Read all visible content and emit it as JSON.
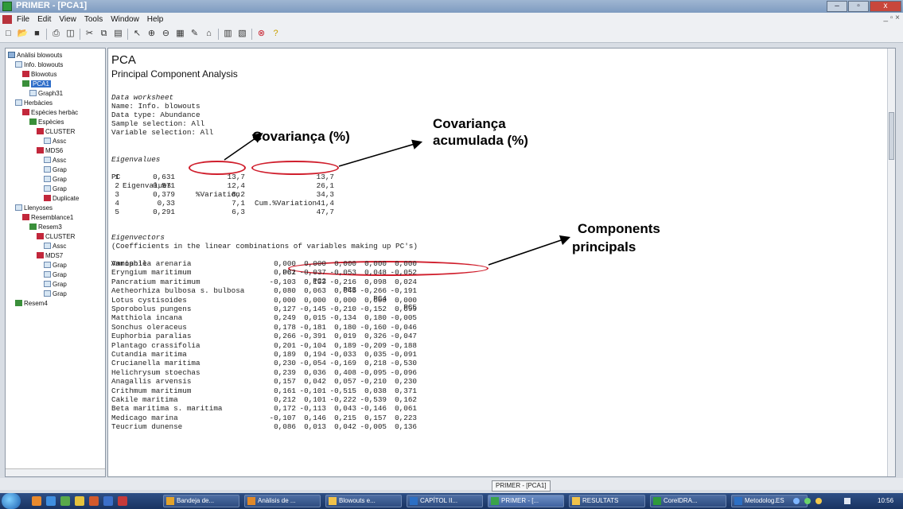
{
  "window": {
    "title": "PRIMER - [PCA1]",
    "controls": {
      "minimize": "–",
      "maximize": "▫",
      "close": "x"
    }
  },
  "menu": {
    "items": [
      "File",
      "Edit",
      "View",
      "Tools",
      "Window",
      "Help"
    ],
    "mdi_controls": "_ ▫ ×"
  },
  "toolbar": {
    "icons": [
      "new-file-icon",
      "open-folder-icon",
      "save-icon",
      "print-icon",
      "print-preview-icon",
      "cut-icon",
      "copy-icon",
      "paste-icon",
      "pointer-icon",
      "zoom-in-icon",
      "zoom-out-icon",
      "table-icon",
      "edit-icon",
      "clipboard-icon",
      "chart-icon",
      "graph-icon",
      "stop-icon",
      "help-icon"
    ]
  },
  "tree": [
    {
      "label": "Anàlisi blowouts",
      "icon": "book",
      "indent": 0
    },
    {
      "label": "Info. blowouts",
      "icon": "doc",
      "indent": 1
    },
    {
      "label": "Blowotus",
      "icon": "ws",
      "indent": 2
    },
    {
      "label": "PCA1",
      "icon": "res",
      "indent": 2,
      "selected": true
    },
    {
      "label": "Graph31",
      "icon": "doc",
      "indent": 3
    },
    {
      "label": "Herbàcies",
      "icon": "doc",
      "indent": 1
    },
    {
      "label": "Espècies herbàc",
      "icon": "ws",
      "indent": 2
    },
    {
      "label": "Espècies",
      "icon": "res",
      "indent": 3
    },
    {
      "label": "CLUSTER",
      "icon": "ws",
      "indent": 4
    },
    {
      "label": "Assc",
      "icon": "doc",
      "indent": 5
    },
    {
      "label": "MDS6",
      "icon": "ws",
      "indent": 4
    },
    {
      "label": "Assc",
      "icon": "doc",
      "indent": 5
    },
    {
      "label": "Grap",
      "icon": "doc",
      "indent": 5
    },
    {
      "label": "Grap",
      "icon": "doc",
      "indent": 5
    },
    {
      "label": "Grap",
      "icon": "doc",
      "indent": 5
    },
    {
      "label": "Duplicate",
      "icon": "ws",
      "indent": 5
    },
    {
      "label": "Llenyoses",
      "icon": "doc",
      "indent": 1
    },
    {
      "label": "Resemblance1",
      "icon": "ws",
      "indent": 2
    },
    {
      "label": "Resem3",
      "icon": "res",
      "indent": 3
    },
    {
      "label": "CLUSTER",
      "icon": "ws",
      "indent": 4
    },
    {
      "label": "Assc",
      "icon": "doc",
      "indent": 5
    },
    {
      "label": "MDS7",
      "icon": "ws",
      "indent": 4
    },
    {
      "label": "Grap",
      "icon": "doc",
      "indent": 5
    },
    {
      "label": "Grap",
      "icon": "doc",
      "indent": 5
    },
    {
      "label": "Grap",
      "icon": "doc",
      "indent": 5
    },
    {
      "label": "Grap",
      "icon": "doc",
      "indent": 5
    },
    {
      "label": "Resem4",
      "icon": "res",
      "indent": 1
    }
  ],
  "doc": {
    "title": "PCA",
    "subtitle": "Principal Component Analysis",
    "header_lines": [
      "Data worksheet",
      "Name: Info. blowouts",
      "Data type: Abundance",
      "Sample selection: All",
      "Variable selection: All"
    ],
    "eigen_title": "Eigenvalues",
    "eigen_headers": [
      "PC",
      "Eigenvalues",
      "%Variation",
      "Cum.%Variation"
    ],
    "eigenvalues": [
      [
        "1",
        "0,631",
        "13,7",
        "13,7"
      ],
      [
        "2",
        "0,571",
        "12,4",
        "26,1"
      ],
      [
        "3",
        "0,379",
        "8,2",
        "34,3"
      ],
      [
        "4",
        "0,33",
        "7,1",
        "41,4"
      ],
      [
        "5",
        "0,291",
        "6,3",
        "47,7"
      ]
    ],
    "eigvec_title": "Eigenvectors",
    "eigvec_note": "(Coefficients in the linear combinations of variables making up PC's)",
    "eigvec_headers": [
      "Variable",
      "PC1",
      "PC2",
      "PC3",
      "PC4",
      "PC5"
    ],
    "eigenvectors": [
      [
        "Ammophila arenaria",
        "0,000",
        "0,000",
        "0,000",
        "0,000",
        "0,000"
      ],
      [
        "Eryngium maritimum",
        "0,082",
        "-0,037",
        "-0,053",
        "0,048",
        "-0,052"
      ],
      [
        "Pancratium maritimum",
        "-0,103",
        "0,133",
        "-0,216",
        "0,098",
        "0,024"
      ],
      [
        "Aetheorhiza bulbosa s. bulbosa",
        "0,080",
        "0,063",
        "0,045",
        "-0,266",
        "-0,191"
      ],
      [
        "Lotus cystisoides",
        "0,000",
        "0,000",
        "0,000",
        "0,000",
        "0,000"
      ],
      [
        "Sporobolus pungens",
        "0,127",
        "-0,145",
        "-0,210",
        "-0,152",
        "0,099"
      ],
      [
        "Matthiola incana",
        "0,249",
        "0,015",
        "-0,134",
        "0,180",
        "-0,005"
      ],
      [
        "Sonchus oleraceus",
        "0,178",
        "-0,181",
        "0,180",
        "-0,160",
        "-0,046"
      ],
      [
        "Euphorbia paralias",
        "0,266",
        "-0,391",
        "0,019",
        "0,326",
        "-0,047"
      ],
      [
        "Plantago crassifolia",
        "0,201",
        "-0,104",
        "0,189",
        "-0,209",
        "-0,188"
      ],
      [
        "Cutandia maritima",
        "0,189",
        "0,194",
        "-0,033",
        "0,035",
        "-0,091"
      ],
      [
        "Crucianella maritima",
        "0,230",
        "-0,054",
        "-0,169",
        "0,218",
        "-0,530"
      ],
      [
        "Helichrysum stoechas",
        "0,239",
        "0,036",
        "0,408",
        "-0,095",
        "-0,096"
      ],
      [
        "Anagallis arvensis",
        "0,157",
        "0,042",
        "0,057",
        "-0,210",
        "0,230"
      ],
      [
        "Crithmum maritimum",
        "0,161",
        "-0,101",
        "-0,515",
        "0,038",
        "0,371"
      ],
      [
        "Cakile maritima",
        "0,212",
        "0,101",
        "-0,222",
        "-0,539",
        "0,162"
      ],
      [
        "Beta maritima s. maritima",
        "0,172",
        "-0,113",
        "0,043",
        "-0,146",
        "0,061"
      ],
      [
        "Medicago marina",
        "-0,107",
        "0,146",
        "0,215",
        "0,157",
        "0,223"
      ],
      [
        "Teucrium dunense",
        "0,086",
        "0,013",
        "0,042",
        "-0,005",
        "0,136"
      ]
    ]
  },
  "annotations": {
    "covariance": "Covariança (%)",
    "cumulative_line1": "Covariança",
    "cumulative_line2": "acumulada (%)",
    "components_line1": "Components",
    "components_line2": "principals",
    "accent_color": "#d01f2d"
  },
  "statusbar": {
    "tooltip": "PRIMER - [PCA1]"
  },
  "taskbar": {
    "items": [
      {
        "label": "Bandeja de...",
        "icon_color": "#e3a32b"
      },
      {
        "label": "Anàlisis de ...",
        "icon_color": "#e0892a"
      },
      {
        "label": "Blowouts e...",
        "icon_color": "#f0c24a"
      },
      {
        "label": "CAPÍTOL II...",
        "icon_color": "#2c6fc4"
      },
      {
        "label": "PRIMER - [...",
        "icon_color": "#3aa34a",
        "active": true
      },
      {
        "label": "RESULTATS",
        "icon_color": "#f0c24a"
      },
      {
        "label": "CorelDRA...",
        "icon_color": "#2f9a3b"
      },
      {
        "label": "Metodolog...",
        "icon_color": "#2c6fc4"
      }
    ],
    "language": "ES",
    "clock": "10:56"
  }
}
